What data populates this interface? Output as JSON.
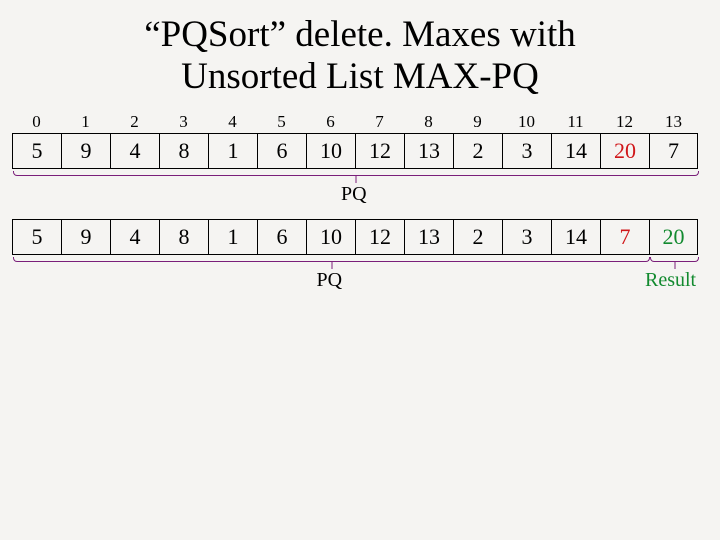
{
  "title_line1": "“PQSort” delete. Maxes with",
  "title_line2": "Unsorted List MAX-PQ",
  "indices": [
    "0",
    "1",
    "2",
    "3",
    "4",
    "5",
    "6",
    "7",
    "8",
    "9",
    "10",
    "11",
    "12",
    "13"
  ],
  "row1": {
    "values": [
      "5",
      "9",
      "4",
      "8",
      "1",
      "6",
      "10",
      "12",
      "13",
      "2",
      "3",
      "14",
      "20",
      "7"
    ],
    "highlight_index": 12,
    "highlight_class": "red",
    "bracket_span": 14,
    "pq_label": "PQ"
  },
  "row2": {
    "values": [
      "5",
      "9",
      "4",
      "8",
      "1",
      "6",
      "10",
      "12",
      "13",
      "2",
      "3",
      "14",
      "7",
      "20"
    ],
    "highlights": [
      {
        "index": 12,
        "class": "red"
      },
      {
        "index": 13,
        "class": "green"
      }
    ],
    "bracket_span": 13,
    "pq_label": "PQ",
    "result_bracket_index": 13,
    "result_label": "Result"
  }
}
